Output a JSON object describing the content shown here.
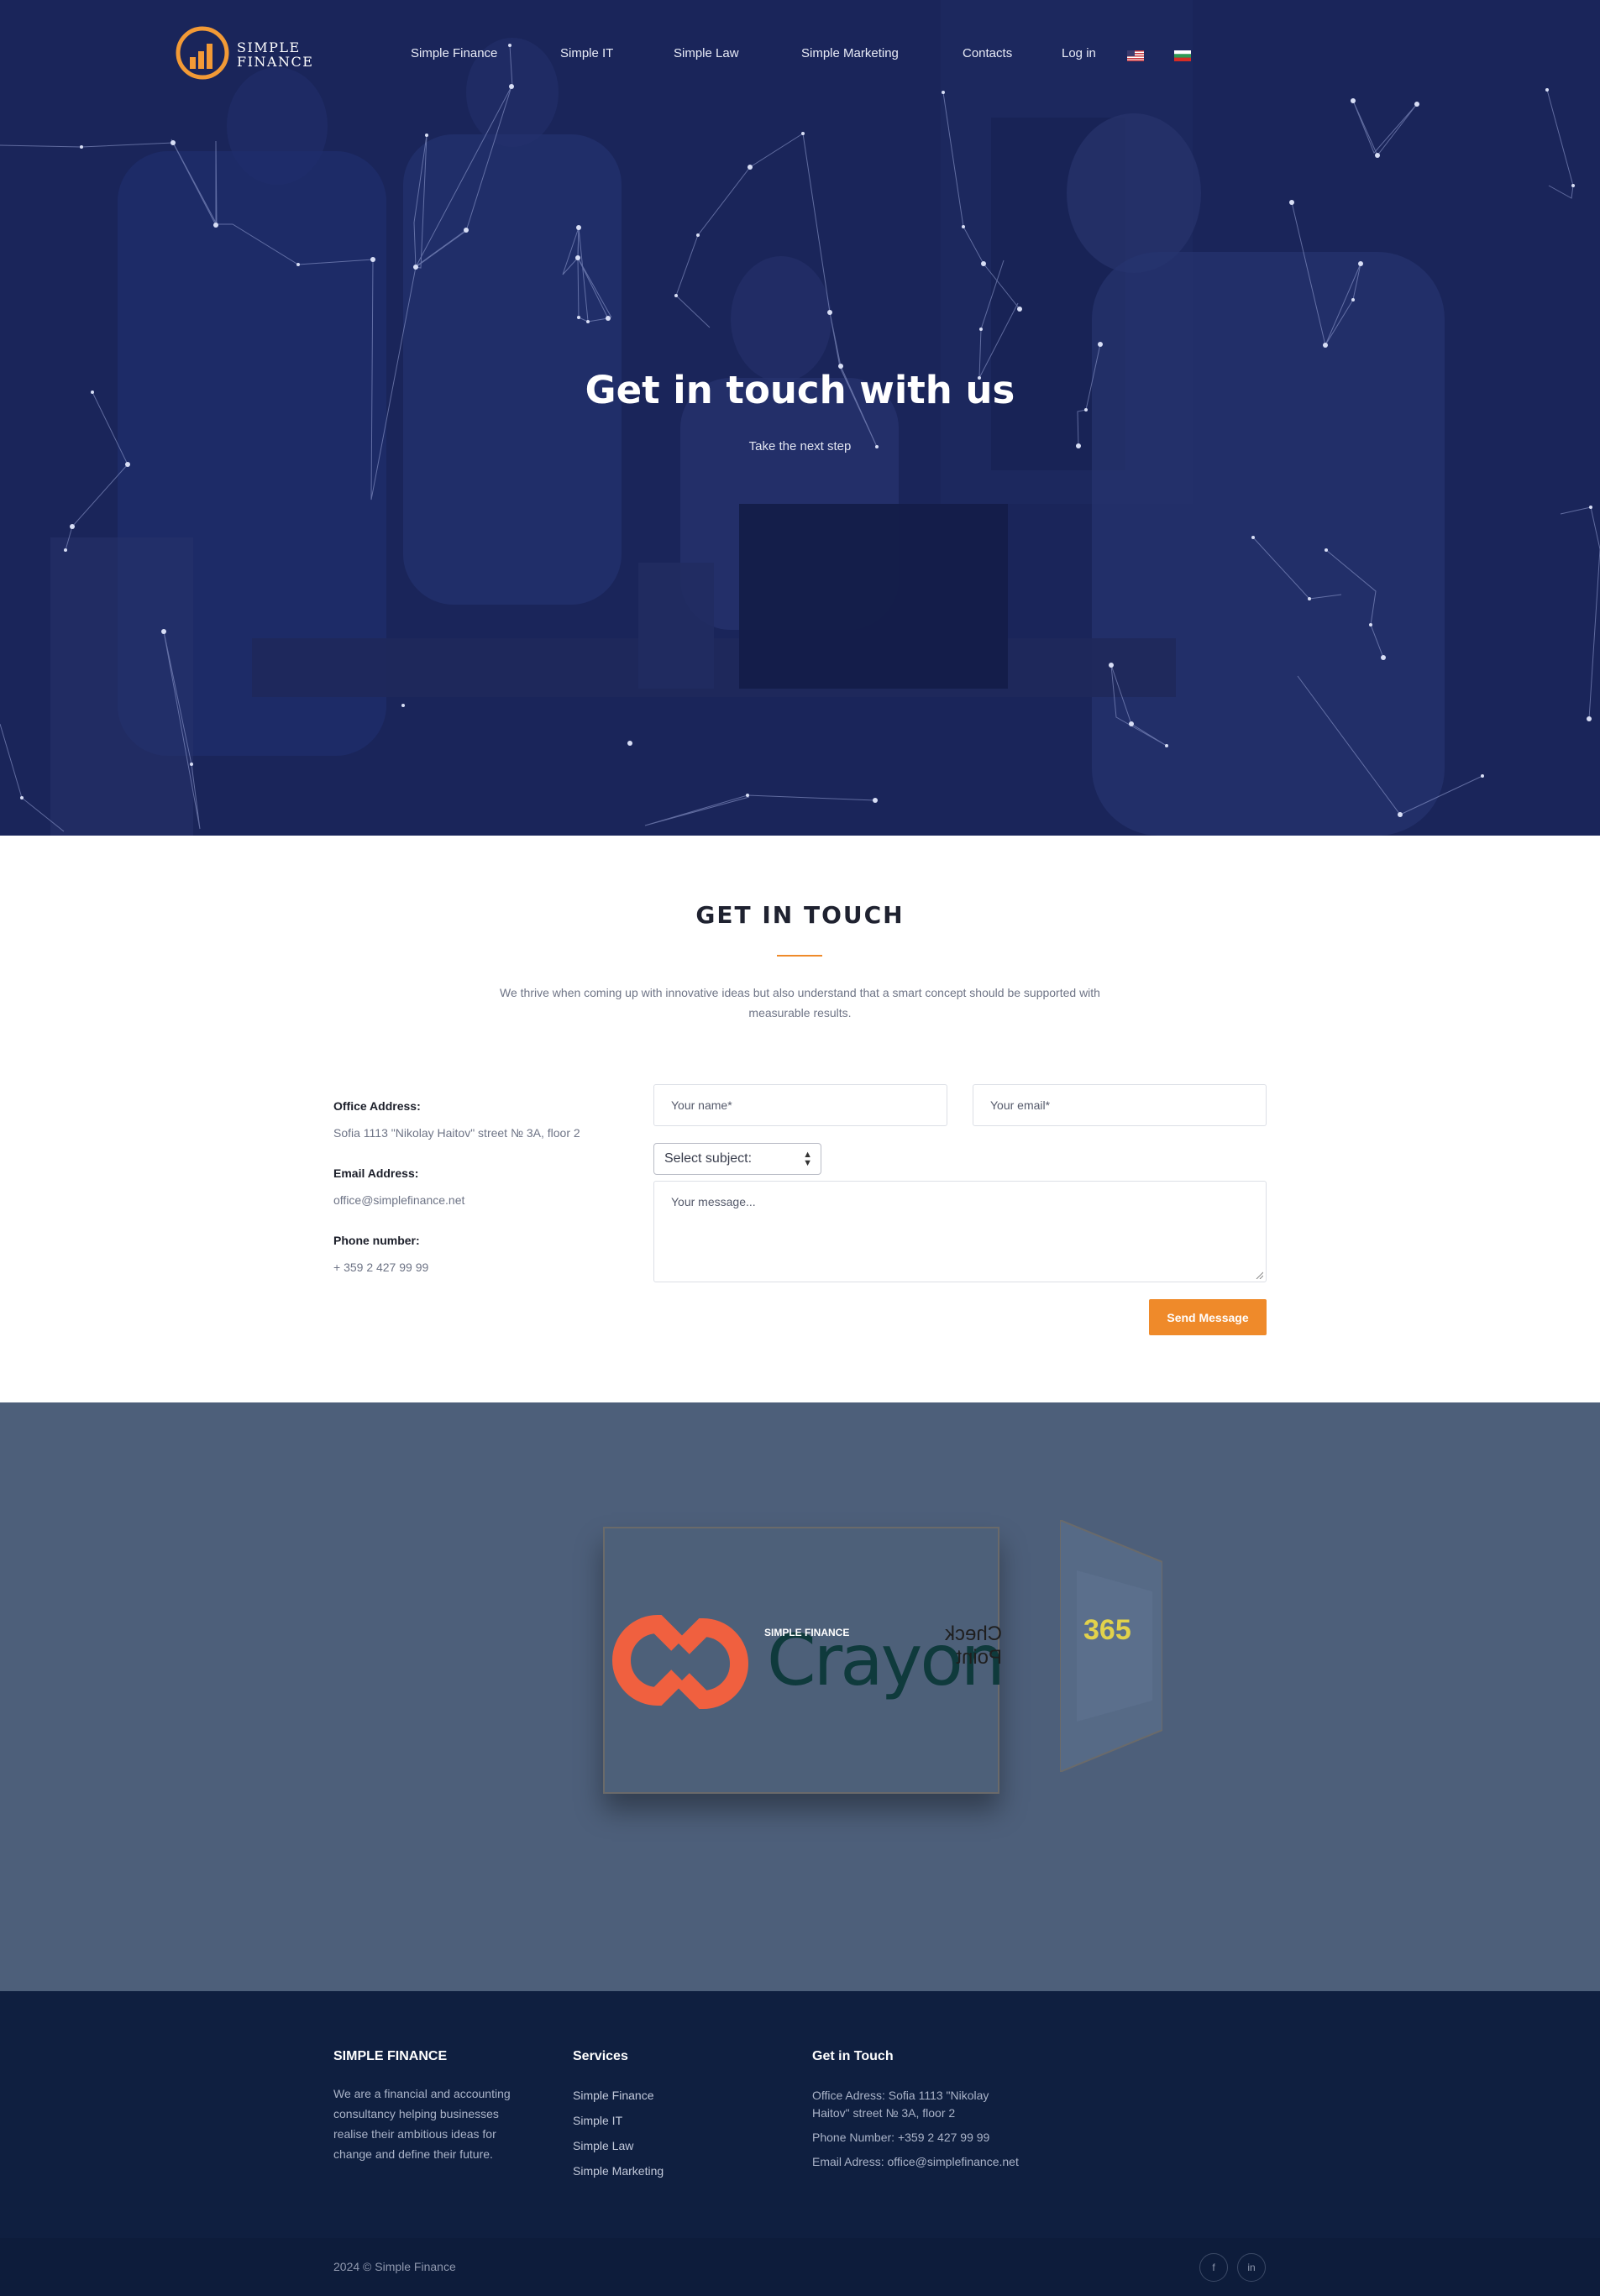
{
  "nav": {
    "logo_line1": "SIMPLE",
    "logo_line2": "FINANCE",
    "items": [
      "Simple Finance",
      "Simple IT",
      "Simple Law",
      "Simple Marketing",
      "Contacts",
      "Log in"
    ],
    "languages": [
      "en-flag-icon",
      "bg-flag-icon"
    ]
  },
  "hero": {
    "title": "Get in touch with us",
    "subtitle": "Take the next step"
  },
  "contact": {
    "title": "GET IN TOUCH",
    "intro": "We thrive when coming up with innovative ideas but also understand that a smart concept should be supported with measurable results.",
    "office_label": "Office Address:",
    "office_value": "Sofia 1113 \"Nikolay Haitov\" street № 3A, floor 2",
    "email_label": "Email Address:",
    "email_value": "office@simplefinance.net",
    "phone_label": "Phone number:",
    "phone_value": "+ 359 2 427 99 99",
    "form": {
      "name_placeholder": "Your name*",
      "email_placeholder": "Your email*",
      "subject_selected": "Select subject:",
      "message_placeholder": "Your message...",
      "send_label": "Send Message"
    }
  },
  "partners": {
    "main_logo": "Crayon",
    "mini_logos": [
      "SIMPLE FINANCE",
      "Check Point",
      "365"
    ]
  },
  "footer": {
    "about_title": "SIMPLE FINANCE",
    "about_text": "We are a financial and accounting consultancy helping businesses realise their ambitious ideas for change and define their future.",
    "services_title": "Services",
    "services": [
      "Simple Finance",
      "Simple IT",
      "Simple Law",
      "Simple Marketing"
    ],
    "touch_title": "Get in Touch",
    "touch_office": "Office Adress: Sofia 1113 \"Nikolay Haitov\" street № 3A, floor 2",
    "touch_phone": "Phone Number: +359 2 427 99 99",
    "touch_email": "Email Adress: office@simplefinance.net",
    "copyright": "2024 © Simple Finance",
    "social": [
      {
        "icon": "facebook-icon",
        "glyph": "f"
      },
      {
        "icon": "linkedin-icon",
        "glyph": "in"
      }
    ]
  },
  "colors": {
    "accent": "#ef8a2a",
    "hero_overlay": "#1d2a63",
    "partners_bg": "#4d5f7a",
    "footer_bg": "#0f1f40"
  }
}
